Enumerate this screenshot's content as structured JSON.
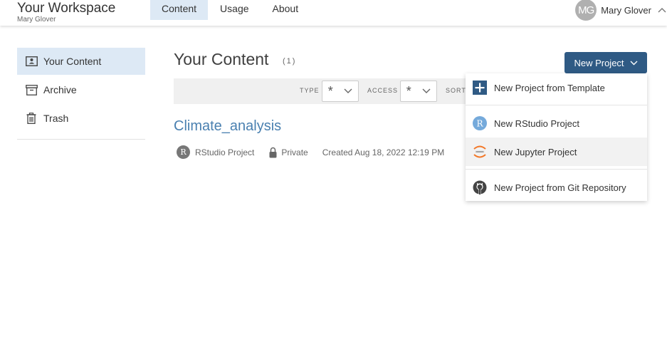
{
  "header": {
    "workspace_title": "Your Workspace",
    "workspace_user": "Mary Glover",
    "tabs": [
      {
        "label": "Content",
        "active": true
      },
      {
        "label": "Usage",
        "active": false
      },
      {
        "label": "About",
        "active": false
      }
    ],
    "avatar_initials": "MG",
    "user_name": "Mary Glover"
  },
  "sidebar": {
    "items": [
      {
        "label": "Your Content",
        "icon": "user-card-icon",
        "active": true
      },
      {
        "label": "Archive",
        "icon": "archive-box-icon",
        "active": false
      },
      {
        "label": "Trash",
        "icon": "trash-icon",
        "active": false
      }
    ]
  },
  "main": {
    "title": "Your Content",
    "count": "(1)",
    "filters": {
      "type_label": "TYPE",
      "type_value": "*",
      "access_label": "ACCESS",
      "access_value": "*",
      "sort_label": "SORT"
    },
    "project": {
      "name": "Climate_analysis",
      "type": "RStudio Project",
      "access": "Private",
      "created": "Created Aug 18, 2022 12:19 PM"
    }
  },
  "new_project": {
    "button_label": "New Project",
    "menu": [
      {
        "label": "New Project from Template",
        "icon": "template-plus-icon"
      },
      {
        "label": "New RStudio Project",
        "icon": "rstudio-icon"
      },
      {
        "label": "New Jupyter Project",
        "icon": "jupyter-icon"
      },
      {
        "label": "New Project from Git Repository",
        "icon": "github-icon"
      }
    ]
  },
  "colors": {
    "accent": "#2f5a84",
    "active_bg": "#dde9f5",
    "link": "#4a80b0"
  }
}
